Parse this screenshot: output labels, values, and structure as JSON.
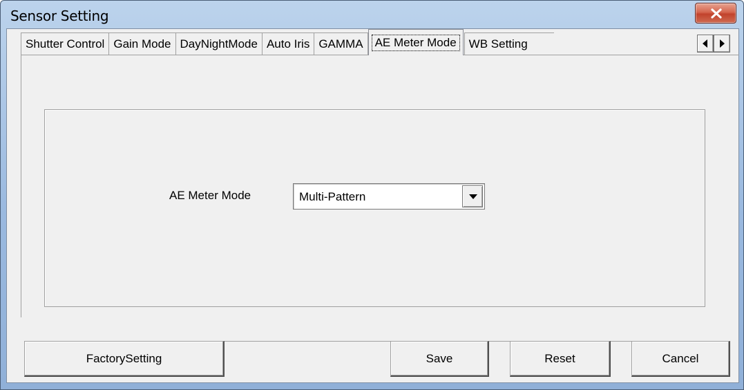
{
  "window": {
    "title": "Sensor Setting"
  },
  "tabs": [
    {
      "label": "Shutter Control"
    },
    {
      "label": "Gain Mode"
    },
    {
      "label": "DayNightMode"
    },
    {
      "label": "Auto Iris"
    },
    {
      "label": "GAMMA"
    },
    {
      "label": "AE Meter Mode",
      "active": true
    },
    {
      "label": "WB Setting"
    }
  ],
  "ae_meter": {
    "label": "AE Meter Mode",
    "selected": "Multi-Pattern"
  },
  "buttons": {
    "factory": "FactorySetting",
    "save": "Save",
    "reset": "Reset",
    "cancel": "Cancel"
  },
  "icons": {
    "close": "close-icon",
    "tab_scroll_left": "triangle-left-icon",
    "tab_scroll_right": "triangle-right-icon",
    "dropdown": "chevron-down-icon"
  },
  "colors": {
    "titlebar": "#9ab9df",
    "client_bg": "#f0f0f0",
    "close_button": "#c1432c"
  }
}
